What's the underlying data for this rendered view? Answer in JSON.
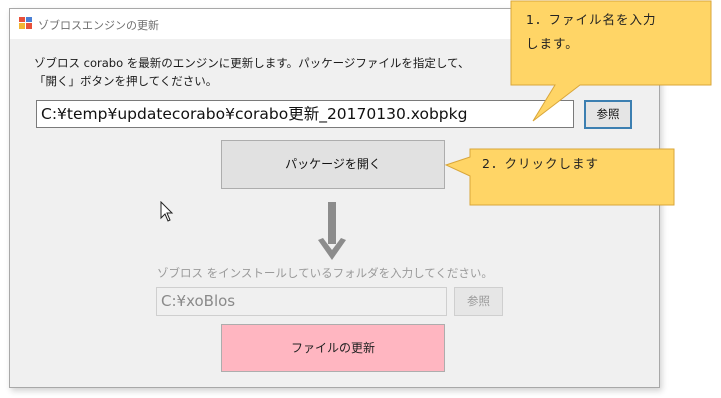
{
  "window": {
    "title": "ゾブロスエンジンの更新"
  },
  "instruction": {
    "line1": "ゾブロス corabo を最新のエンジンに更新します。パッケージファイルを指定して、",
    "line2": "「開く」ボタンを押してください。"
  },
  "package_path": {
    "value": "C:¥temp¥updatecorabo¥corabo更新_20170130.xobpkg"
  },
  "browse_button": {
    "label": "参照"
  },
  "open_button": {
    "label": "パッケージを開く"
  },
  "folder_section": {
    "label": "ゾブロス をインストールしているフォルダを入力してください。",
    "value": "C:¥xoBlos",
    "browse_label": "参照"
  },
  "update_button": {
    "label": "ファイルの更新"
  },
  "callouts": [
    {
      "line1": "1．ファイル名を入力",
      "line2": "します。"
    },
    {
      "line1": "2．クリックします"
    }
  ],
  "colors": {
    "callout_fill": "#ffd566",
    "callout_border": "#d9a63a",
    "update_button": "#ffb6c1",
    "focus_border": "#3c7fb1"
  },
  "icons": {
    "app": "app-icon",
    "arrow": "arrow-down-icon",
    "cursor": "mouse-cursor-icon"
  }
}
